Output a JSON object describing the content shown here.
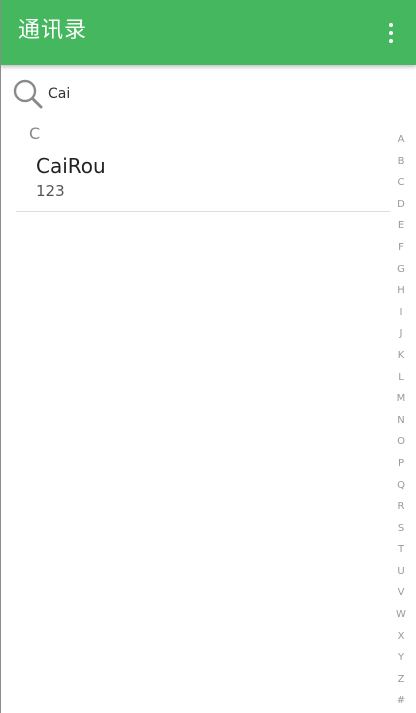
{
  "app": {
    "title": "通讯录"
  },
  "toolbar": {
    "menu_icon": "overflow-menu-icon",
    "background_color": "#45b85f",
    "title_color": "#ffffff"
  },
  "search": {
    "icon": "search-icon",
    "value": "Cai",
    "placeholder": ""
  },
  "contacts": {
    "section_letter": "C",
    "items": [
      {
        "name": "CaiRou",
        "number": "123"
      }
    ]
  },
  "index_bar": {
    "letters": [
      "A",
      "B",
      "C",
      "D",
      "E",
      "F",
      "G",
      "H",
      "I",
      "J",
      "K",
      "L",
      "M",
      "N",
      "O",
      "P",
      "Q",
      "R",
      "S",
      "T",
      "U",
      "V",
      "W",
      "X",
      "Y",
      "Z",
      "#"
    ]
  }
}
